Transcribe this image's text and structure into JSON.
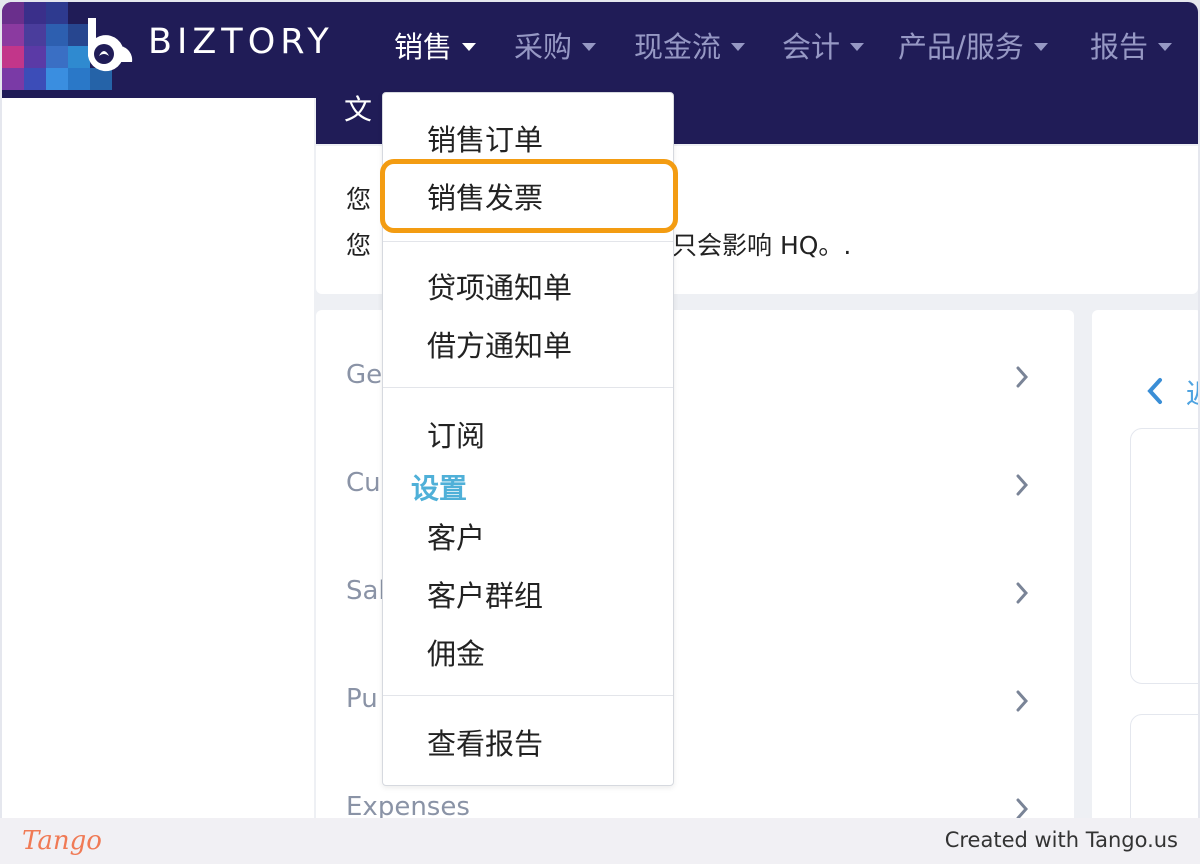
{
  "app": {
    "brand": "BIZTORY"
  },
  "topnav": {
    "items": [
      {
        "label": "销售",
        "active": true
      },
      {
        "label": "采购"
      },
      {
        "label": "现金流"
      },
      {
        "label": "会计"
      },
      {
        "label": "产品/服务"
      },
      {
        "label": "报告"
      }
    ]
  },
  "dropdown": {
    "items": [
      {
        "label": "销售订单"
      },
      {
        "label": "销售发票",
        "highlighted": true
      },
      {
        "label": "贷项通知单"
      },
      {
        "label": "借方通知单"
      },
      {
        "label": "订阅"
      },
      {
        "label": "客户"
      },
      {
        "label": "客户群组"
      },
      {
        "label": "佣金"
      },
      {
        "label": "查看报告"
      }
    ],
    "heading": "设置"
  },
  "page": {
    "band_glyph": "文",
    "notice": {
      "line1": "您",
      "line2_prefix": "您",
      "line2_suffix": "只会影响 HQ。."
    },
    "settings_rows": [
      {
        "label": "Ge"
      },
      {
        "label": "Cu"
      },
      {
        "label": "Sal"
      },
      {
        "label": "Pu"
      },
      {
        "label": "Expenses"
      }
    ],
    "right_panel": {
      "back_text": "返"
    }
  },
  "footer": {
    "logo": "Tango",
    "created": "Created with Tango.us"
  },
  "colors": {
    "nav_bg": "#201c57",
    "highlight": "#f39c12",
    "accent": "#4fb0d8"
  }
}
